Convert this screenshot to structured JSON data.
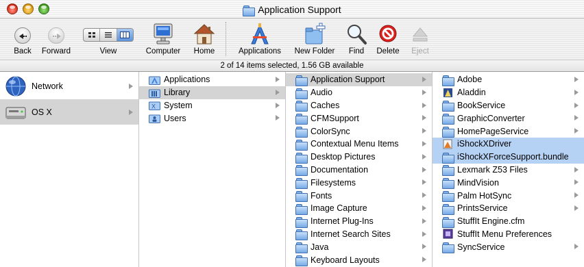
{
  "window": {
    "title": "Application Support"
  },
  "toolbar": {
    "back": "Back",
    "forward": "Forward",
    "view": "View",
    "computer": "Computer",
    "home": "Home",
    "applications": "Applications",
    "new_folder": "New Folder",
    "find": "Find",
    "delete": "Delete",
    "eject": "Eject"
  },
  "status": "2 of 14 items selected, 1.56 GB available",
  "columns": {
    "sidebar": [
      {
        "label": "Network",
        "icon": "network-globe-icon"
      },
      {
        "label": "OS X",
        "icon": "hard-disk-icon"
      }
    ],
    "root": [
      {
        "label": "Applications",
        "icon": "applications-folder-icon"
      },
      {
        "label": "Library",
        "icon": "library-folder-icon"
      },
      {
        "label": "System",
        "icon": "system-folder-icon"
      },
      {
        "label": "Users",
        "icon": "users-folder-icon"
      }
    ],
    "library": [
      "Application Support",
      "Audio",
      "Caches",
      "CFMSupport",
      "ColorSync",
      "Contextual Menu Items",
      "Desktop Pictures",
      "Documentation",
      "Filesystems",
      "Fonts",
      "Image Capture",
      "Internet Plug-Ins",
      "Internet Search Sites",
      "Java",
      "Keyboard Layouts"
    ],
    "application_support": [
      "Adobe",
      "Aladdin",
      "BookService",
      "GraphicConverter",
      "HomePageService",
      "iShockXDriver",
      "iShockXForceSupport.bundle",
      "Lexmark Z53 Files",
      "MindVision",
      "Palm HotSync",
      "PrintsService",
      "StuffIt Engine.cfm",
      "StuffIt Menu Preferences",
      "SyncService"
    ]
  },
  "colors": {
    "selection_blue": "#b5d1f4",
    "selection_gray": "#d4d4d4",
    "folder_blue": "#76aae6"
  }
}
